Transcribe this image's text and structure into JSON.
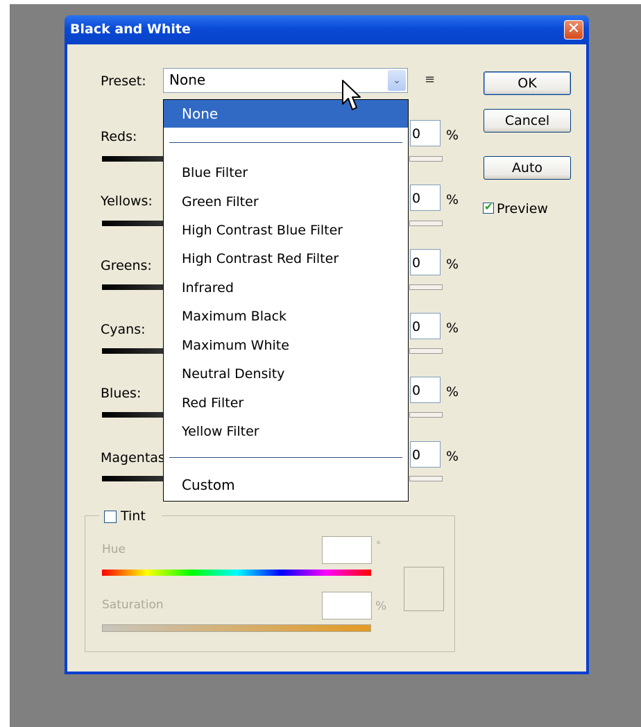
{
  "window": {
    "title": "Black and White",
    "close_glyph": "✕"
  },
  "preset": {
    "label": "Preset:",
    "value": "None",
    "arrow": "⌄",
    "menu_icon": "≡"
  },
  "buttons": {
    "ok": "OK",
    "cancel": "Cancel",
    "auto": "Auto"
  },
  "preview": {
    "label": "Preview",
    "checked": true
  },
  "channels": [
    {
      "label": "Reds:",
      "value": "0",
      "unit": "%"
    },
    {
      "label": "Yellows:",
      "value": "0",
      "unit": "%"
    },
    {
      "label": "Greens:",
      "value": "0",
      "unit": "%"
    },
    {
      "label": "Cyans:",
      "value": "0",
      "unit": "%"
    },
    {
      "label": "Blues:",
      "value": "0",
      "unit": "%"
    },
    {
      "label": "Magentas:",
      "value": "0",
      "unit": "%"
    }
  ],
  "dropdown": {
    "selected": "None",
    "items": [
      "Blue Filter",
      "Green Filter",
      "High Contrast Blue Filter",
      "High Contrast Red Filter",
      "Infrared",
      "Maximum Black",
      "Maximum White",
      "Neutral Density",
      "Red Filter",
      "Yellow Filter"
    ],
    "custom": "Custom"
  },
  "tint": {
    "label": "Tint",
    "checked": false,
    "hue_label": "Hue",
    "hue_unit": "°",
    "saturation_label": "Saturation",
    "saturation_unit": "%"
  },
  "colors": {
    "title_bar": "#0a4ad6",
    "selection": "#316ac5",
    "dialog_bg": "#ece9d8",
    "backdrop": "#808080"
  }
}
